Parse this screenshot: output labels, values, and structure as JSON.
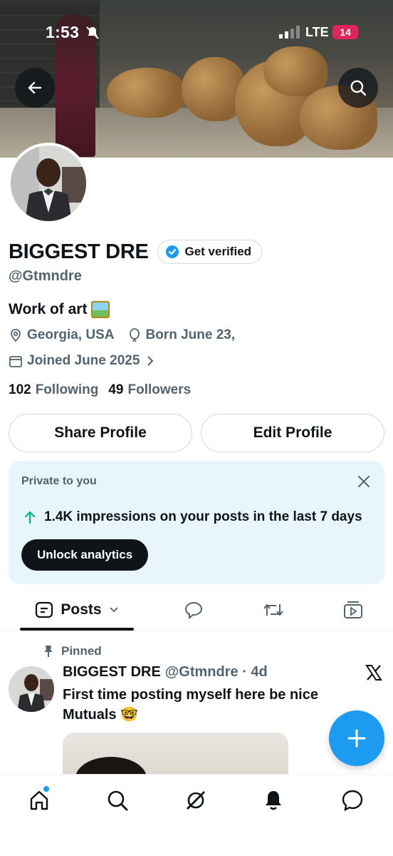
{
  "status_bar": {
    "time": "1:53",
    "network": "LTE",
    "battery": "14"
  },
  "profile": {
    "name": "BIGGEST DRE",
    "verify_label": "Get verified",
    "handle": "@Gtmndre",
    "bio": "Work of art",
    "location": "Georgia, USA",
    "birthday": "Born June 23, ",
    "joined": "Joined June 2025",
    "following_count": "102",
    "following_label": "Following",
    "followers_count": "49",
    "followers_label": "Followers"
  },
  "actions": {
    "share": "Share Profile",
    "edit": "Edit Profile"
  },
  "analytics": {
    "private_label": "Private to you",
    "stat": "1.4K impressions on your posts in the last 7 days",
    "unlock_label": "Unlock analytics"
  },
  "tabs": {
    "posts": "Posts"
  },
  "post": {
    "pinned_label": "Pinned",
    "author": "BIGGEST DRE",
    "handle_time": "@Gtmndre · 4d",
    "text": "First time posting myself here be nice Mutuals 🤓"
  },
  "colors": {
    "accent": "#1d9bf0",
    "text": "#0f1419",
    "muted": "#536471",
    "card_bg": "#e8f5fd",
    "up_arrow": "#00ba7c"
  }
}
